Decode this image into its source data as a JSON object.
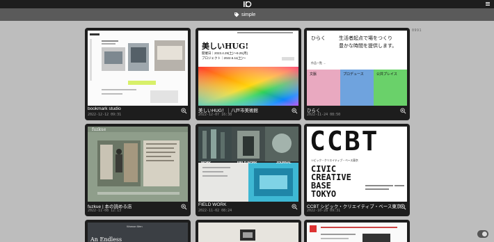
{
  "tag": {
    "label": "simple",
    "icon": "tag-icon"
  },
  "counter": "0991",
  "cards": [
    {
      "title": "bookmark studio",
      "date": "2022-12-12 09:31"
    },
    {
      "title": "美しいHUG！｜八戸市美術館",
      "date": "2022-12-07 16:38"
    },
    {
      "title": "ひらく",
      "date": "2022-11-24 08:50"
    },
    {
      "title": "fuzkue | 本の読める店",
      "date": "2022-11-08 12:13"
    },
    {
      "title": "FIELD WORK",
      "date": "2022-11-02 08:24"
    },
    {
      "title": "CCBT シビック・クリエイティブ・ベース東京",
      "date": "2022-10-28 09:31"
    }
  ],
  "thumbs": {
    "hug": {
      "heading": "美しいHUG!",
      "line1": "開催日｜2023.4.29(土)～9.25(月)",
      "line2": "プロジェクト｜2022.6.11(土)～"
    },
    "hiraku": {
      "logo": "ひらく",
      "copy1": "生活者起点で場をつくり",
      "copy2": "豊かな時間を提供します。",
      "cat1": "文脈",
      "cat2": "プロデュース",
      "cat3": "公共プレイス",
      "link": "作品一覧 →"
    },
    "fuzkue": {
      "logo": "fuzkue"
    },
    "fieldwork": {
      "word1": "WORK",
      "word2": "FIELD WORK",
      "word3": "JOURNAL"
    },
    "ccbt": {
      "logo": "CCBT",
      "sub": "シビック・クリエイティブ・ベース東京",
      "big1": "CIVIC",
      "big2": "CREATIVE",
      "big3": "BASE",
      "big4": "TOKYO"
    },
    "bottom": {
      "endless": "An Endless",
      "woman": "Woman Men"
    }
  },
  "colors": {
    "hiraku_pink": "#e9a9c0",
    "hiraku_blue": "#6fa3de",
    "hiraku_green": "#6ad16a",
    "card_bg": "#1d1d1d"
  }
}
